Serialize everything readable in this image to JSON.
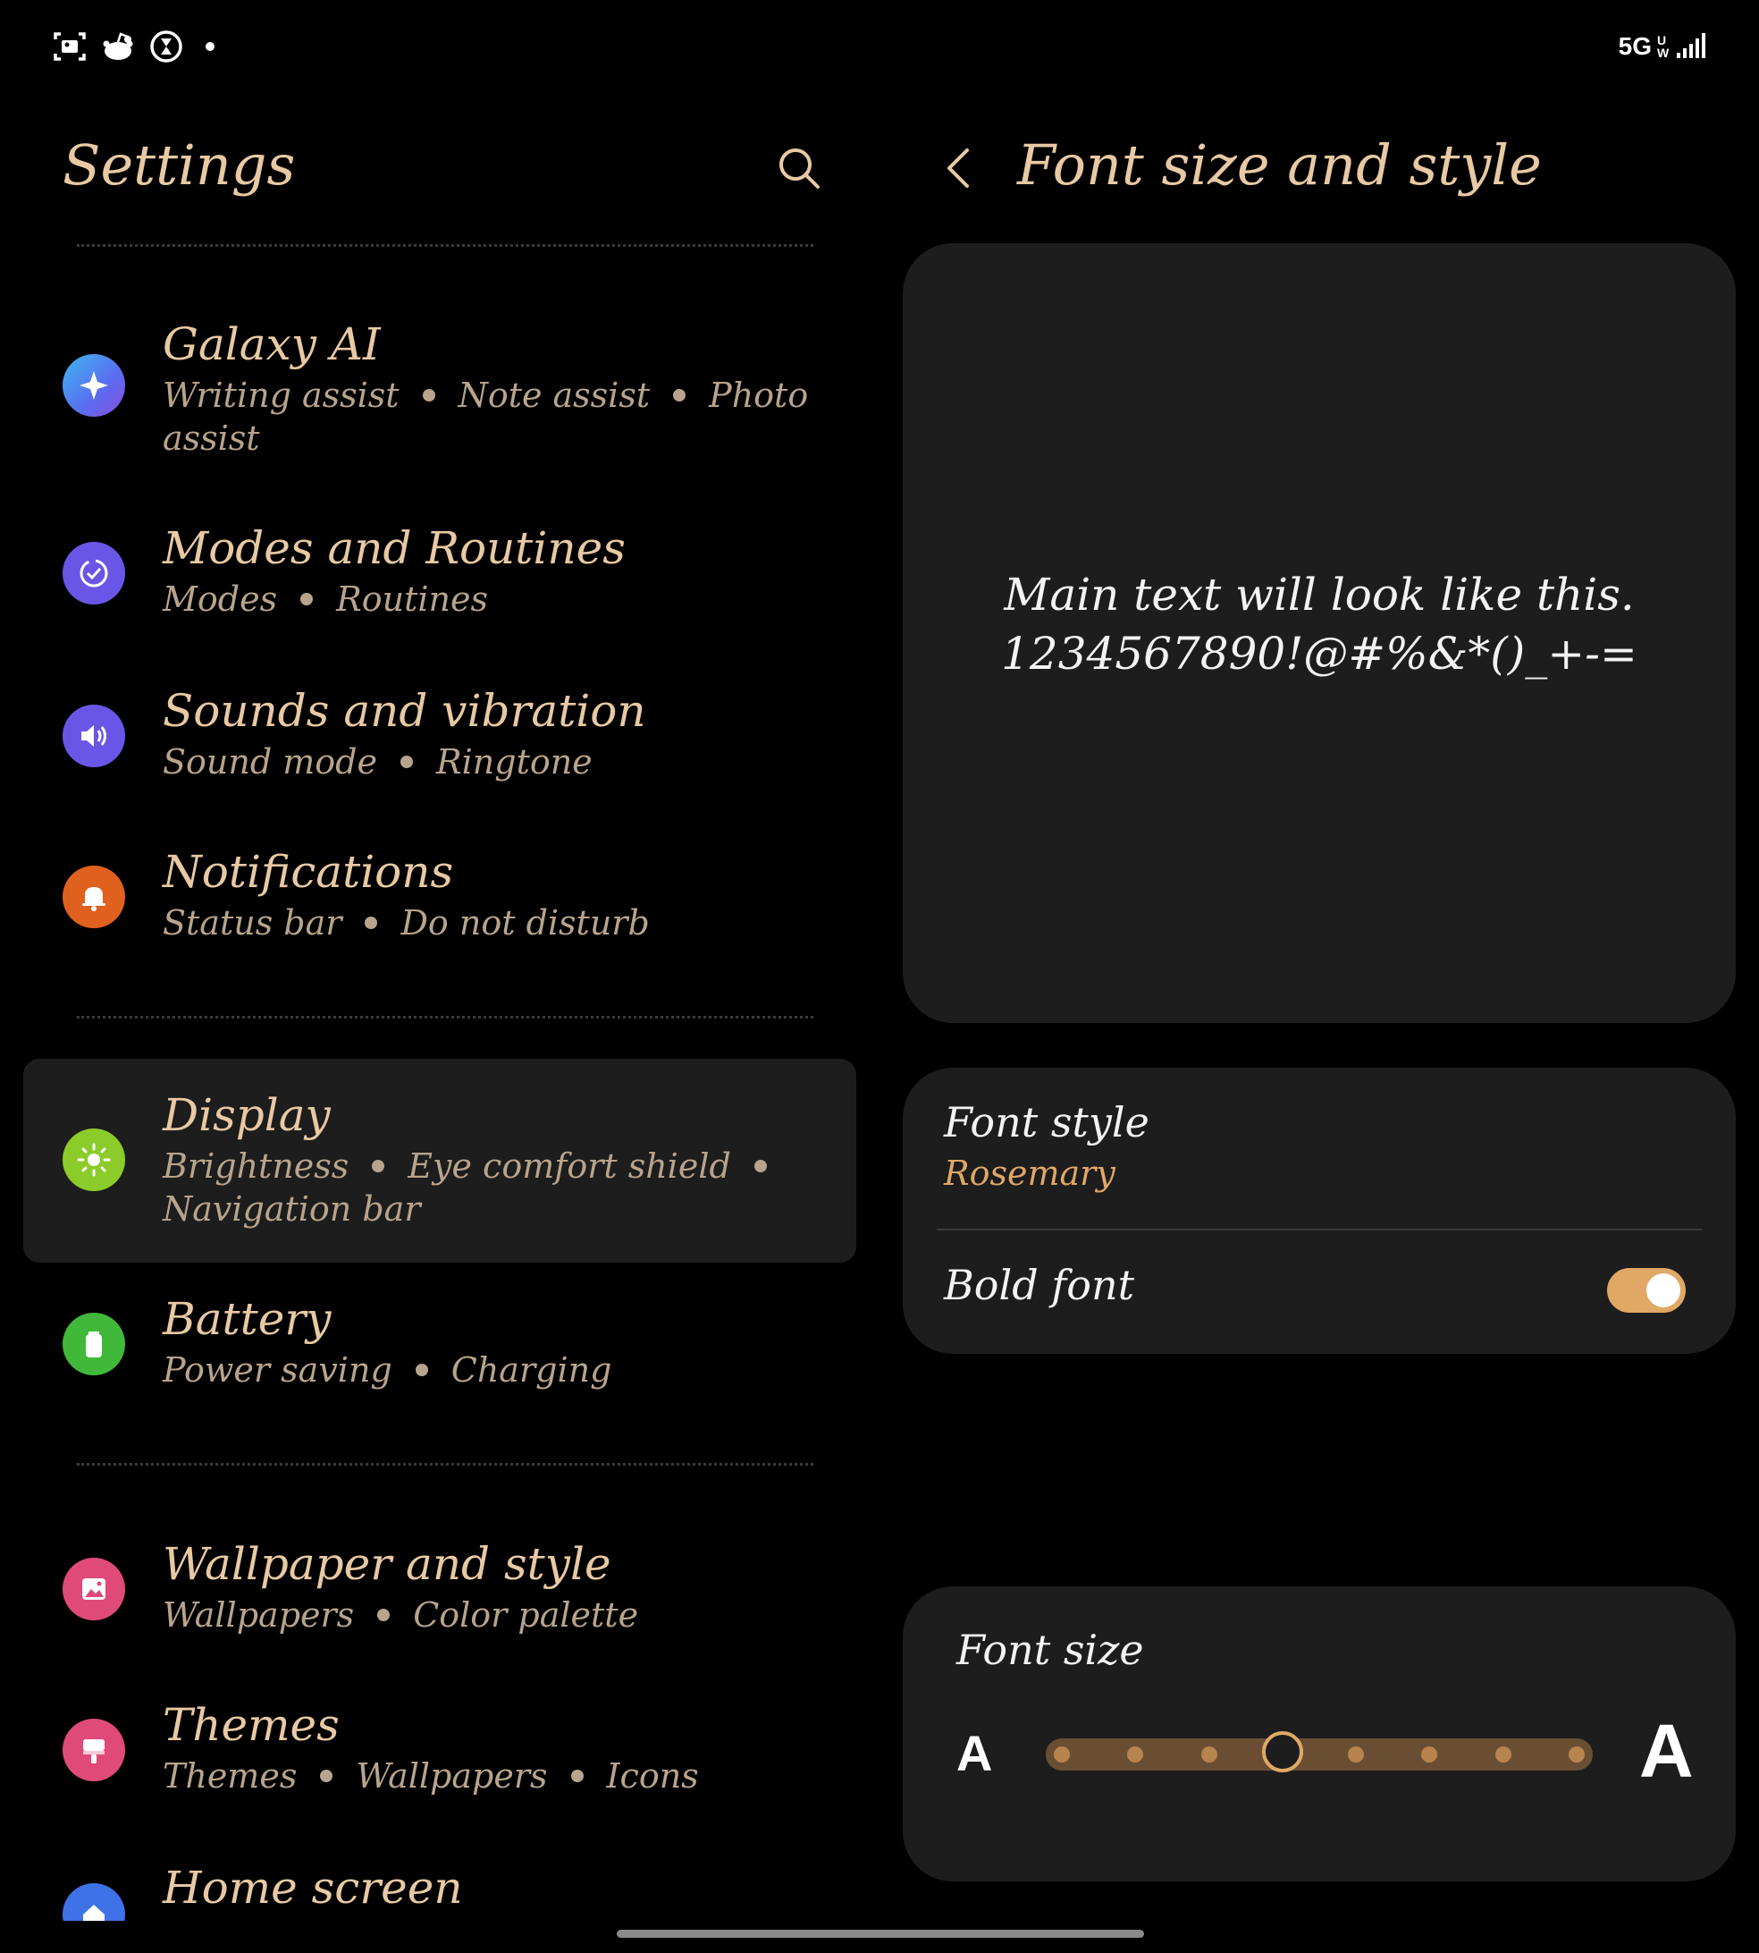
{
  "status_bar": {
    "left_icons": [
      "screenshot-icon",
      "reddit-icon",
      "hourglass-icon",
      "dot-icon"
    ],
    "network": "5G",
    "network_sub": "UW"
  },
  "left_pane": {
    "title": "Settings",
    "search_icon": "search-icon",
    "items": [
      {
        "title": "Galaxy AI",
        "subtitle_parts": [
          "Writing assist",
          "Note assist",
          "Photo assist"
        ],
        "icon": "sparkle-icon",
        "color": "#4a8ef0"
      },
      {
        "title": "Modes and Routines",
        "subtitle_parts": [
          "Modes",
          "Routines"
        ],
        "icon": "check-circle-icon",
        "color": "#6a56e6"
      },
      {
        "title": "Sounds and vibration",
        "subtitle_parts": [
          "Sound mode",
          "Ringtone"
        ],
        "icon": "volume-icon",
        "color": "#6a56e6"
      },
      {
        "title": "Notifications",
        "subtitle_parts": [
          "Status bar",
          "Do not disturb"
        ],
        "icon": "bell-icon",
        "color": "#e0611e"
      },
      {
        "title": "Display",
        "subtitle_parts": [
          "Brightness",
          "Eye comfort shield",
          "Navigation bar"
        ],
        "icon": "sun-icon",
        "color": "#8ccc2a"
      },
      {
        "title": "Battery",
        "subtitle_parts": [
          "Power saving",
          "Charging"
        ],
        "icon": "battery-icon",
        "color": "#41b83a"
      },
      {
        "title": "Wallpaper and style",
        "subtitle_parts": [
          "Wallpapers",
          "Color palette"
        ],
        "icon": "image-icon",
        "color": "#e04a79"
      },
      {
        "title": "Themes",
        "subtitle_parts": [
          "Themes",
          "Wallpapers",
          "Icons"
        ],
        "icon": "brush-icon",
        "color": "#e04a79"
      },
      {
        "title": "Home screen",
        "subtitle_parts": [],
        "icon": "home-icon",
        "color": "#3f72e8"
      }
    ]
  },
  "right_pane": {
    "title": "Font size and style",
    "back_icon": "back-arrow-icon",
    "preview_line1": "Main text will look like this.",
    "preview_line2": "1234567890!@#%&*()_+-=",
    "font_style_label": "Font style",
    "font_style_value": "Rosemary",
    "bold_font_label": "Bold font",
    "bold_font_on": true,
    "font_size_label": "Font size",
    "font_size_small_glyph": "A",
    "font_size_large_glyph": "A",
    "font_size_steps": 8,
    "font_size_selected_step": 4
  },
  "colors": {
    "accent": "#e0a865",
    "title_text": "#e8c9a3",
    "subtitle_text": "#b8a48c",
    "card_bg": "#1d1d1d",
    "background": "#000000"
  }
}
